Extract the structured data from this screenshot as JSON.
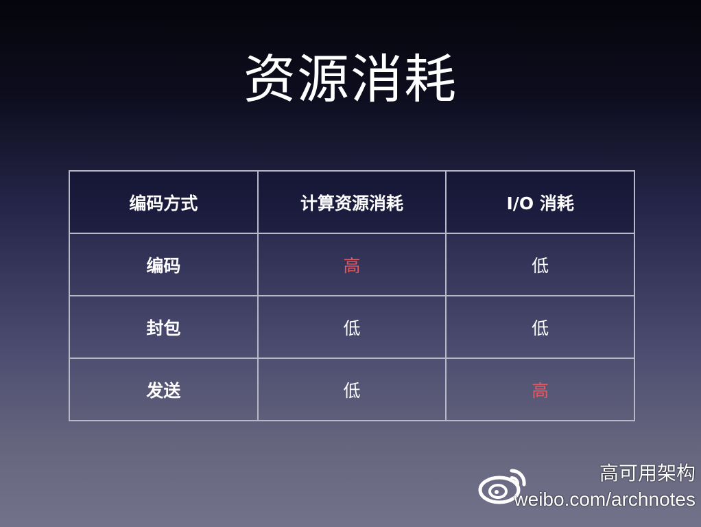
{
  "slide": {
    "title": "资源消耗"
  },
  "table": {
    "headers": [
      "编码方式",
      "计算资源消耗",
      "I/O 消耗"
    ],
    "rows": [
      {
        "label": "编码",
        "compute": "高",
        "io": "低"
      },
      {
        "label": "封包",
        "compute": "低",
        "io": "低"
      },
      {
        "label": "发送",
        "compute": "低",
        "io": "高"
      }
    ],
    "highlight_color": "#e05a64"
  },
  "watermark": {
    "name": "高可用架构",
    "url": "weibo.com/archnotes",
    "icon": "weibo-icon"
  }
}
